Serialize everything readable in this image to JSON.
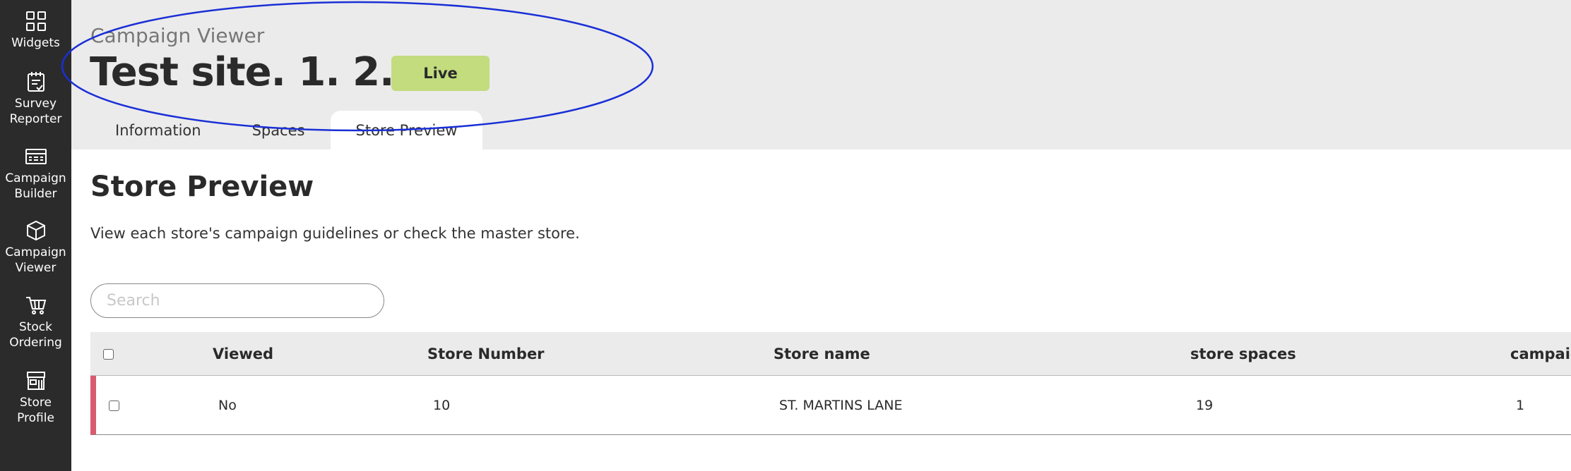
{
  "sidebar": {
    "items": [
      {
        "label": "Widgets",
        "icon": "widgets-grid-icon"
      },
      {
        "label": "Survey\nReporter",
        "icon": "clipboard-checklist-icon"
      },
      {
        "label": "Campaign\nBuilder",
        "icon": "builder-board-icon"
      },
      {
        "label": "Campaign\nViewer",
        "icon": "cube-box-icon"
      },
      {
        "label": "Stock\nOrdering",
        "icon": "shopping-cart-icon"
      },
      {
        "label": "Store\nProfile",
        "icon": "storefront-icon"
      }
    ]
  },
  "header": {
    "app_title": "Campaign Viewer",
    "page_title": "Test site. 1. 2. 3",
    "status": "Live",
    "status_color": "#c2dc7e",
    "tabs": [
      {
        "label": "Information",
        "active": false
      },
      {
        "label": "Spaces",
        "active": false
      },
      {
        "label": "Store Preview",
        "active": true
      }
    ]
  },
  "main": {
    "title": "Store Preview",
    "description": "View each store's campaign guidelines or check the master store.",
    "search": {
      "placeholder": "Search",
      "value": ""
    },
    "table": {
      "columns": [
        "Viewed",
        "Store Number",
        "Store name",
        "store spaces",
        "campaig"
      ],
      "rows": [
        {
          "viewed": "No",
          "store_number": "10",
          "store_name": "ST. MARTINS LANE",
          "store_spaces": "19",
          "campaign": "1",
          "accent": "#d65c6e"
        }
      ]
    }
  },
  "colors": {
    "sidebar_bg": "#2b2b2b",
    "header_bg": "#ebebeb",
    "annotation": "#1a2fd6"
  }
}
